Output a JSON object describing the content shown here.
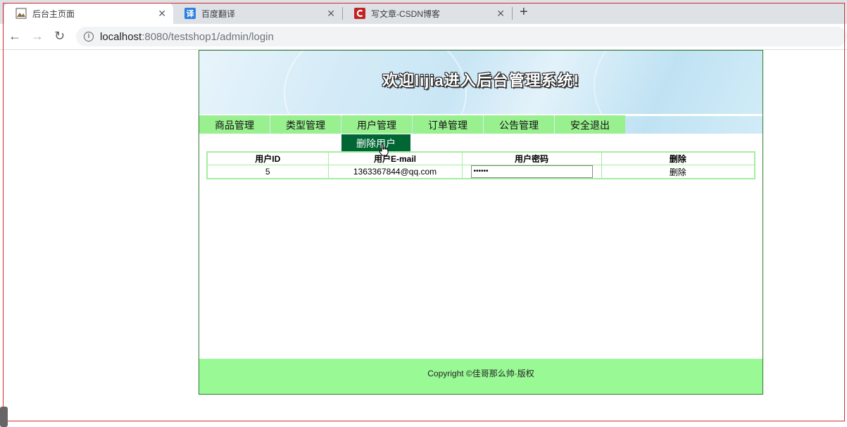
{
  "browser": {
    "tabs": [
      {
        "label": "后台主页面",
        "active": true
      },
      {
        "label": "百度翻译",
        "icon_text": "译"
      },
      {
        "label": "写文章-CSDN博客"
      }
    ],
    "url_host": "localhost",
    "url_rest": ":8080/testshop1/admin/login"
  },
  "page": {
    "welcome": "欢迎lijia进入后台管理系统!",
    "menu": [
      "商品管理",
      "类型管理",
      "用户管理",
      "订单管理",
      "公告管理",
      "安全退出"
    ],
    "dropdown_item": "删除用户",
    "table": {
      "headers": [
        "用户ID",
        "用户E-mail",
        "用户密码",
        "删除"
      ],
      "rows": [
        {
          "id": "5",
          "email": "1363367844@qq.com",
          "password_mask": "••••••",
          "action": "删除"
        }
      ]
    },
    "footer": "Copyright ©佳哥那么帅·版权"
  },
  "colors": {
    "menu_bg": "#99f08f",
    "dropdown_bg": "#006633",
    "footer_bg": "#99f995",
    "border": "#d9292a"
  }
}
